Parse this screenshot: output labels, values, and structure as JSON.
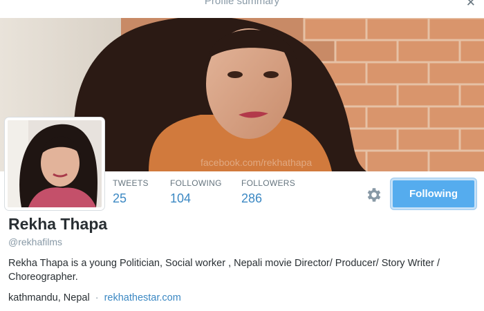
{
  "dialog": {
    "title": "Profile summary",
    "close_icon": "close-icon"
  },
  "header": {
    "watermark": "facebook.com/rekhathapa"
  },
  "profile": {
    "name": "Rekha Thapa",
    "handle": "@rekhafilms",
    "bio": "Rekha Thapa is a young Politician, Social worker , Nepali movie Director/ Producer/ Story Writer / Choreographer.",
    "location": "kathmandu, Nepal",
    "separator": "·",
    "website": "rekhathestar.com"
  },
  "stats": [
    {
      "label": "TWEETS",
      "value": "25"
    },
    {
      "label": "FOLLOWING",
      "value": "104"
    },
    {
      "label": "FOLLOWERS",
      "value": "286"
    }
  ],
  "actions": {
    "settings_icon": "gear-icon",
    "follow_button_label": "Following"
  },
  "colors": {
    "accent": "#55acee",
    "link": "#3b88c3",
    "muted": "#8899a6",
    "text": "#292f33"
  }
}
